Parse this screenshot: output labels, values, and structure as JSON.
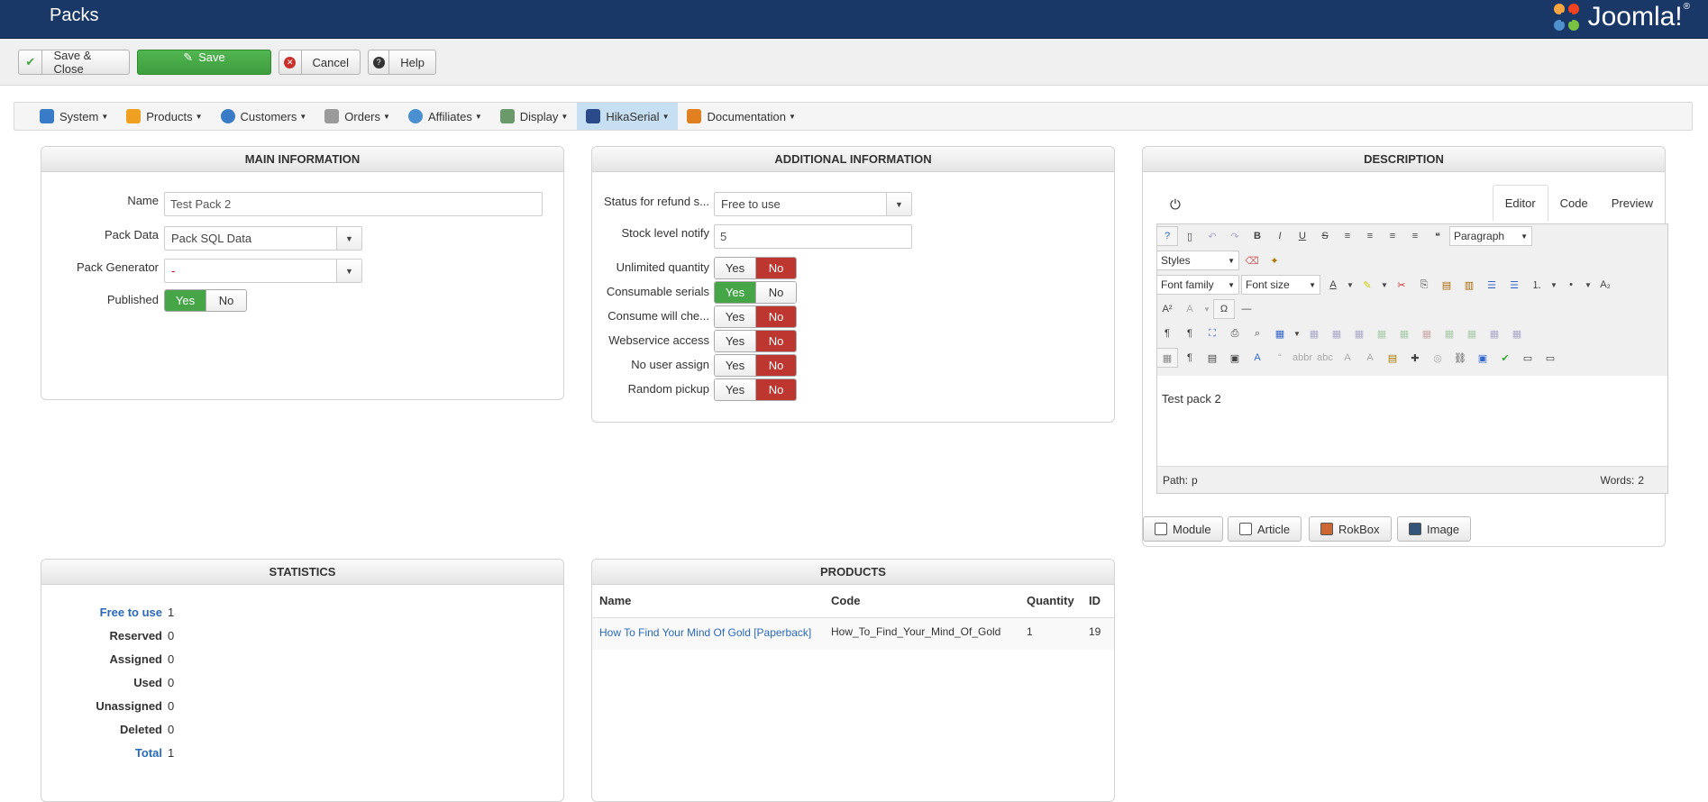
{
  "header": {
    "title": "Packs",
    "logo_text": "Joomla!"
  },
  "toolbar": {
    "save_close": "Save & Close",
    "save": "Save",
    "cancel": "Cancel",
    "help": "Help"
  },
  "menu": {
    "items": [
      {
        "label": "System",
        "icon": "wrench-icon",
        "color": "#3a7bc8"
      },
      {
        "label": "Products",
        "icon": "products-icon",
        "color": "#f0a020"
      },
      {
        "label": "Customers",
        "icon": "customers-icon",
        "color": "#3a7bc8"
      },
      {
        "label": "Orders",
        "icon": "orders-icon",
        "color": "#8a8a8a"
      },
      {
        "label": "Affiliates",
        "icon": "affiliates-icon",
        "color": "#4a90d0"
      },
      {
        "label": "Display",
        "icon": "display-icon",
        "color": "#6a9a6a"
      },
      {
        "label": "HikaSerial",
        "icon": "hikaserial-icon",
        "color": "#2a4a8a"
      },
      {
        "label": "Documentation",
        "icon": "documentation-icon",
        "color": "#e08020"
      }
    ]
  },
  "main_info": {
    "heading": "MAIN INFORMATION",
    "name_label": "Name",
    "name_value": "Test Pack 2",
    "pack_data_label": "Pack Data",
    "pack_data_value": "Pack SQL Data",
    "pack_generator_label": "Pack Generator",
    "pack_generator_value": "-",
    "published_label": "Published",
    "yes": "Yes",
    "no": "No"
  },
  "additional_info": {
    "heading": "ADDITIONAL INFORMATION",
    "status_label": "Status for refund s...",
    "status_value": "Free to use",
    "stock_label": "Stock level notify",
    "stock_value": "5",
    "unlimited_label": "Unlimited quantity",
    "consumable_label": "Consumable serials",
    "consume_check_label": "Consume will che...",
    "webservice_label": "Webservice access",
    "no_user_label": "No user assign",
    "random_label": "Random pickup",
    "yes": "Yes",
    "no": "No"
  },
  "description": {
    "heading": "DESCRIPTION",
    "tabs": [
      "Editor",
      "Code",
      "Preview"
    ],
    "format_select": "Paragraph",
    "styles_select": "Styles",
    "font_family_select": "Font family",
    "font_size_select": "Font size",
    "content": "Test pack 2",
    "path_label": "Path:",
    "path_value": "p",
    "words_label": "Words:",
    "words_value": "2",
    "buttons": [
      "Module",
      "Article",
      "RokBox",
      "Image"
    ]
  },
  "statistics": {
    "heading": "STATISTICS",
    "rows": [
      {
        "label": "Free to use",
        "value": "1",
        "link": true
      },
      {
        "label": "Reserved",
        "value": "0",
        "link": false
      },
      {
        "label": "Assigned",
        "value": "0",
        "link": false
      },
      {
        "label": "Used",
        "value": "0",
        "link": false
      },
      {
        "label": "Unassigned",
        "value": "0",
        "link": false
      },
      {
        "label": "Deleted",
        "value": "0",
        "link": false
      },
      {
        "label": "Total",
        "value": "1",
        "link": true
      }
    ]
  },
  "products": {
    "heading": "PRODUCTS",
    "columns": [
      "Name",
      "Code",
      "Quantity",
      "ID"
    ],
    "rows": [
      {
        "name": "How To Find Your Mind Of Gold [Paperback]",
        "code": "How_To_Find_Your_Mind_Of_Gold",
        "quantity": "1",
        "id": "19"
      }
    ]
  }
}
